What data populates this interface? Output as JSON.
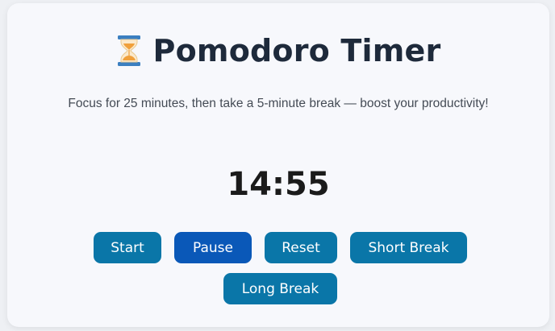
{
  "app": {
    "title": "Pomodoro Timer",
    "title_icon": "hourglass-icon",
    "subtitle": "Focus for 25 minutes, then take a 5-minute break — boost your productivity!",
    "timer": "14:55"
  },
  "controls": {
    "start_label": "Start",
    "pause_label": "Pause",
    "reset_label": "Reset",
    "short_break_label": "Short Break",
    "long_break_label": "Long Break"
  },
  "colors": {
    "button_primary": "#0a76a8",
    "button_active": "#0a58b8",
    "title_text": "#1e2a3b",
    "timer_text": "#1b1b1b",
    "card_bg": "#f7f8fc"
  }
}
